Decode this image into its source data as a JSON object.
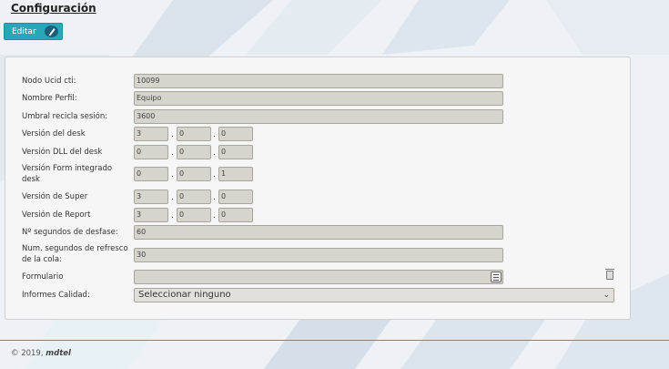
{
  "header": {
    "title": "Configuración",
    "edit_label": "Editar"
  },
  "form": {
    "nodo_label": "Nodo Ucid cti:",
    "nodo_value": "10099",
    "perfil_label": "Nombre Perfil:",
    "perfil_value": "Equipo",
    "umbral_label": "Umbral recicla sesión:",
    "umbral_value": "3600",
    "desk_label": "Versión del desk",
    "desk_values": [
      "3",
      "0",
      "0"
    ],
    "dll_label": "Versión DLL del desk",
    "dll_values": [
      "0",
      "0",
      "0"
    ],
    "form_label": "Versión Form integrado desk",
    "form_values": [
      "0",
      "0",
      "1"
    ],
    "super_label": "Versión de Super",
    "super_values": [
      "3",
      "0",
      "0"
    ],
    "report_label": "Versión de Report",
    "report_values": [
      "3",
      "0",
      "0"
    ],
    "desfase_label": "Nº segundos de desfase:",
    "desfase_value": "60",
    "refresco_label": "Num. segundos de refresco de la cola:",
    "refresco_value": "30",
    "formulario_label": "Formulario",
    "formulario_value": "",
    "informes_label": "Informes Calidad:",
    "informes_value": "Seleccionar ninguno"
  },
  "footer": {
    "copyright": "© 2019,",
    "brand": "mdtel"
  },
  "colors": {
    "accent": "#2aa6b8",
    "field_bg": "#d7d3cd"
  }
}
